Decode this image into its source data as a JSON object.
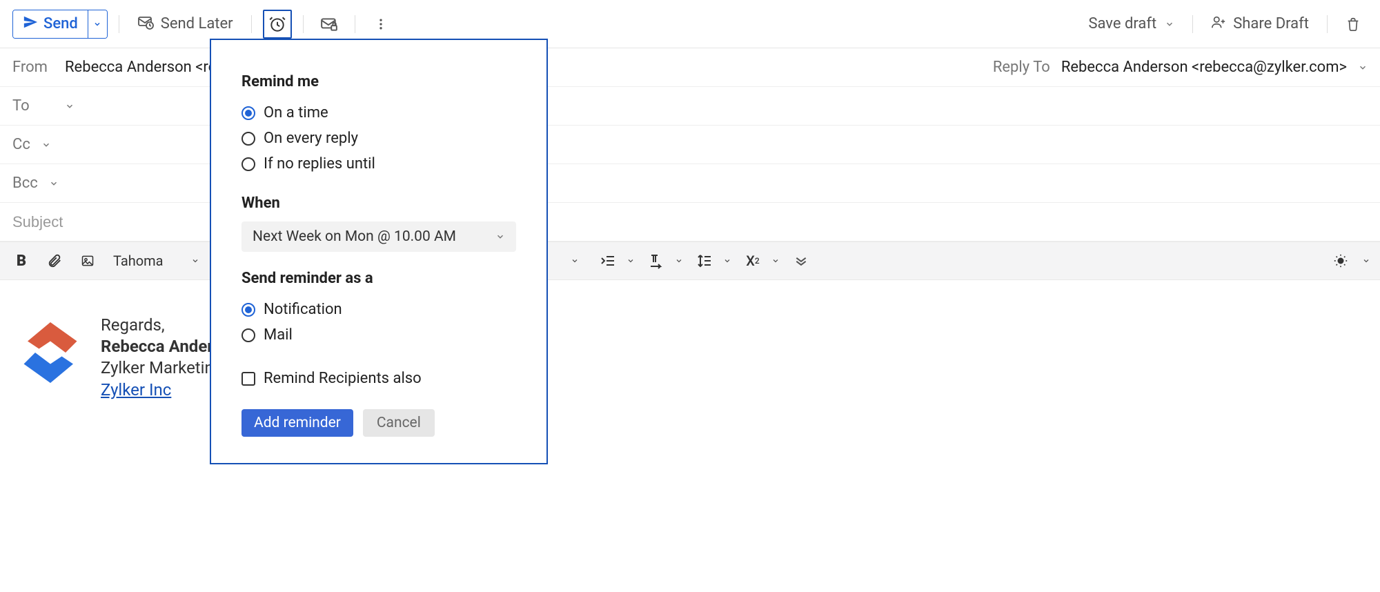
{
  "toolbar": {
    "send_label": "Send",
    "send_later_label": "Send Later",
    "save_draft_label": "Save draft",
    "share_draft_label": "Share Draft"
  },
  "header": {
    "from_label": "From",
    "from_value": "Rebecca Anderson <rebecca",
    "to_label": "To",
    "cc_label": "Cc",
    "bcc_label": "Bcc",
    "subject_placeholder": "Subject",
    "reply_to_label": "Reply To",
    "reply_to_value": "Rebecca Anderson <rebecca@zylker.com>"
  },
  "format": {
    "font_name": "Tahoma"
  },
  "signature": {
    "regards": "Regards,",
    "name": "Rebecca Anders",
    "role": "Zylker Marketing",
    "link_text": "Zylker Inc"
  },
  "reminder": {
    "remind_me_title": "Remind me",
    "opt_on_time": "On a time",
    "opt_every_reply": "On every reply",
    "opt_no_replies": "If no replies until",
    "when_title": "When",
    "when_value": "Next Week on Mon @ 10.00 AM",
    "send_as_title": "Send reminder as a",
    "opt_notification": "Notification",
    "opt_mail": "Mail",
    "remind_recipients": "Remind Recipients also",
    "add_btn": "Add reminder",
    "cancel_btn": "Cancel"
  }
}
